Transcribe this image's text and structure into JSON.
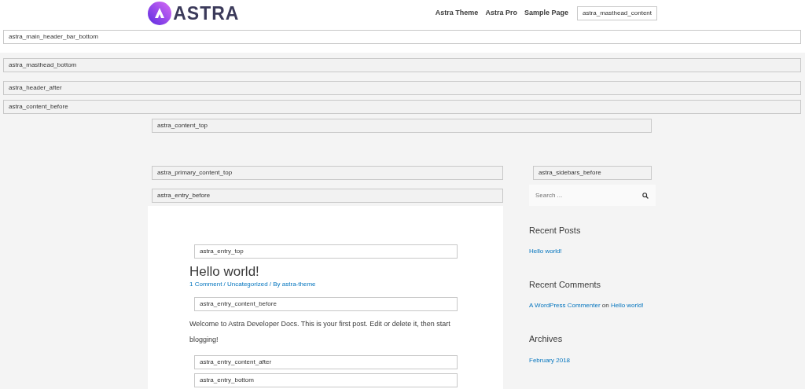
{
  "header": {
    "logo": {
      "wordmark": "ASTRA"
    },
    "nav": [
      {
        "label": "Astra Theme"
      },
      {
        "label": "Astra Pro"
      },
      {
        "label": "Sample Page"
      }
    ],
    "masthead_hook": "astra_masthead_content",
    "bottom_hook": "astra_main_header_bar_bottom"
  },
  "full_width_hooks": [
    "astra_masthead_bottom",
    "astra_header_after",
    "astra_content_before"
  ],
  "content_top_hook": "astra_content_top",
  "primary": {
    "hooks": [
      "astra_primary_content_top",
      "astra_entry_before"
    ],
    "article": {
      "entry_top_hook": "astra_entry_top",
      "title": "Hello world!",
      "meta": "1 Comment / Uncategorized / By astra-theme",
      "content_before_hook": "astra_entry_content_before",
      "body": "Welcome to Astra Developer Docs. This is your first post. Edit or delete it, then start blogging!",
      "content_after_hook": "astra_entry_content_after",
      "bottom_hook": "astra_entry_bottom"
    }
  },
  "sidebar": {
    "hook": "astra_sidebars_before",
    "search": {
      "placeholder": "Search ..."
    },
    "widgets": [
      {
        "title": "Recent Posts",
        "kind": "links",
        "links": [
          "Hello world!"
        ]
      },
      {
        "title": "Recent Comments",
        "kind": "comment",
        "author": "A WordPress Commenter",
        "joiner": "on",
        "post": "Hello world!"
      },
      {
        "title": "Archives",
        "kind": "links",
        "links": [
          "February 2018"
        ]
      }
    ]
  }
}
